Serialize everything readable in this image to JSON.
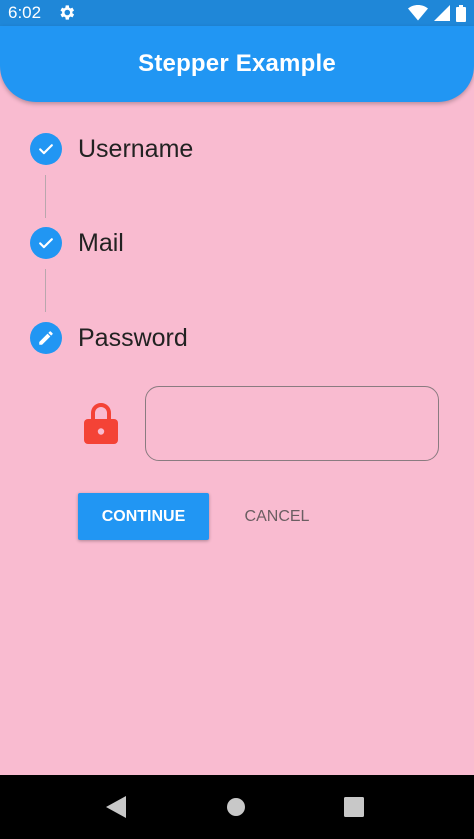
{
  "status_bar": {
    "time": "6:02",
    "icons": [
      "gear-icon",
      "wifi-icon",
      "signal-icon",
      "battery-icon"
    ]
  },
  "app_bar": {
    "title": "Stepper Example"
  },
  "steps": [
    {
      "title": "Username",
      "state": "complete",
      "icon": "check-icon"
    },
    {
      "title": "Mail",
      "state": "complete",
      "icon": "check-icon"
    },
    {
      "title": "Password",
      "state": "editing",
      "icon": "pencil-icon"
    }
  ],
  "password_step": {
    "field_value": "",
    "leading_icon": "lock-icon"
  },
  "controls": {
    "continue_label": "CONTINUE",
    "cancel_label": "CANCEL"
  },
  "navigation_bar": {
    "icons": [
      "back-icon",
      "home-icon",
      "recents-icon"
    ]
  },
  "colors": {
    "primary": "#2196f3",
    "status_bar": "#1f87d8",
    "background": "#f9bbd0",
    "lock": "#f44336",
    "nav_bar": "#000000"
  }
}
